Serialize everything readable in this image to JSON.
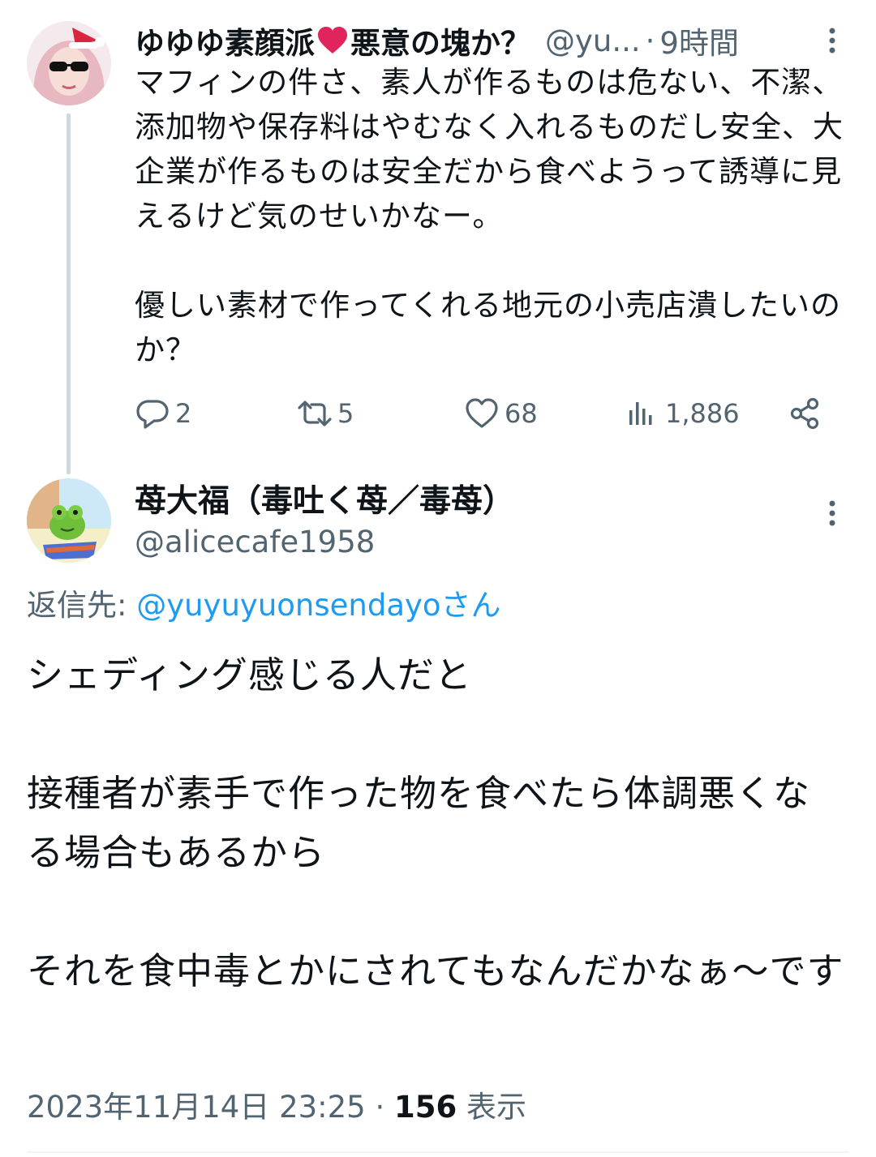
{
  "parent_tweet": {
    "display_name": "ゆゆゆ素顔派",
    "display_name_suffix": "悪意の塊か？",
    "handle": "@yu...",
    "separator": "·",
    "time": "9時間",
    "text": "マフィンの件さ、素人が作るものは危ない、不潔、添加物や保存料はやむなく入れるものだし安全、大企業が作るものは安全だから食べようって誘導に見えるけど気のせいかなー。\n\n優しい素材で作ってくれる地元の小売店潰したいのか？",
    "stats": {
      "replies": "2",
      "retweets": "5",
      "likes": "68",
      "views": "1,886"
    },
    "icons": [
      "reply-icon",
      "retweet-icon",
      "like-icon",
      "views-icon",
      "share-icon",
      "more-icon"
    ]
  },
  "reply_tweet": {
    "display_name": "苺大福（毒吐く苺／毒苺）",
    "handle": "@alicecafe1958",
    "reply_to_label": "返信先: ",
    "reply_to_mention": "@yuyuyuonsendayo",
    "reply_to_suffix": "さん",
    "text": "シェディング感じる人だと\n\n接種者が素手で作った物を食べたら体調悪くなる場合もあるから\n\nそれを食中毒とかにされてもなんだかなぁ〜です",
    "timestamp": "2023年11月14日 23:25",
    "meta_separator": " · ",
    "views_count": "156",
    "views_label": " 表示"
  },
  "colors": {
    "text_primary": "#0f1419",
    "text_secondary": "#536471",
    "link": "#1d9bf0",
    "thread_line": "#cfd9de",
    "heart": "#e0245e"
  }
}
